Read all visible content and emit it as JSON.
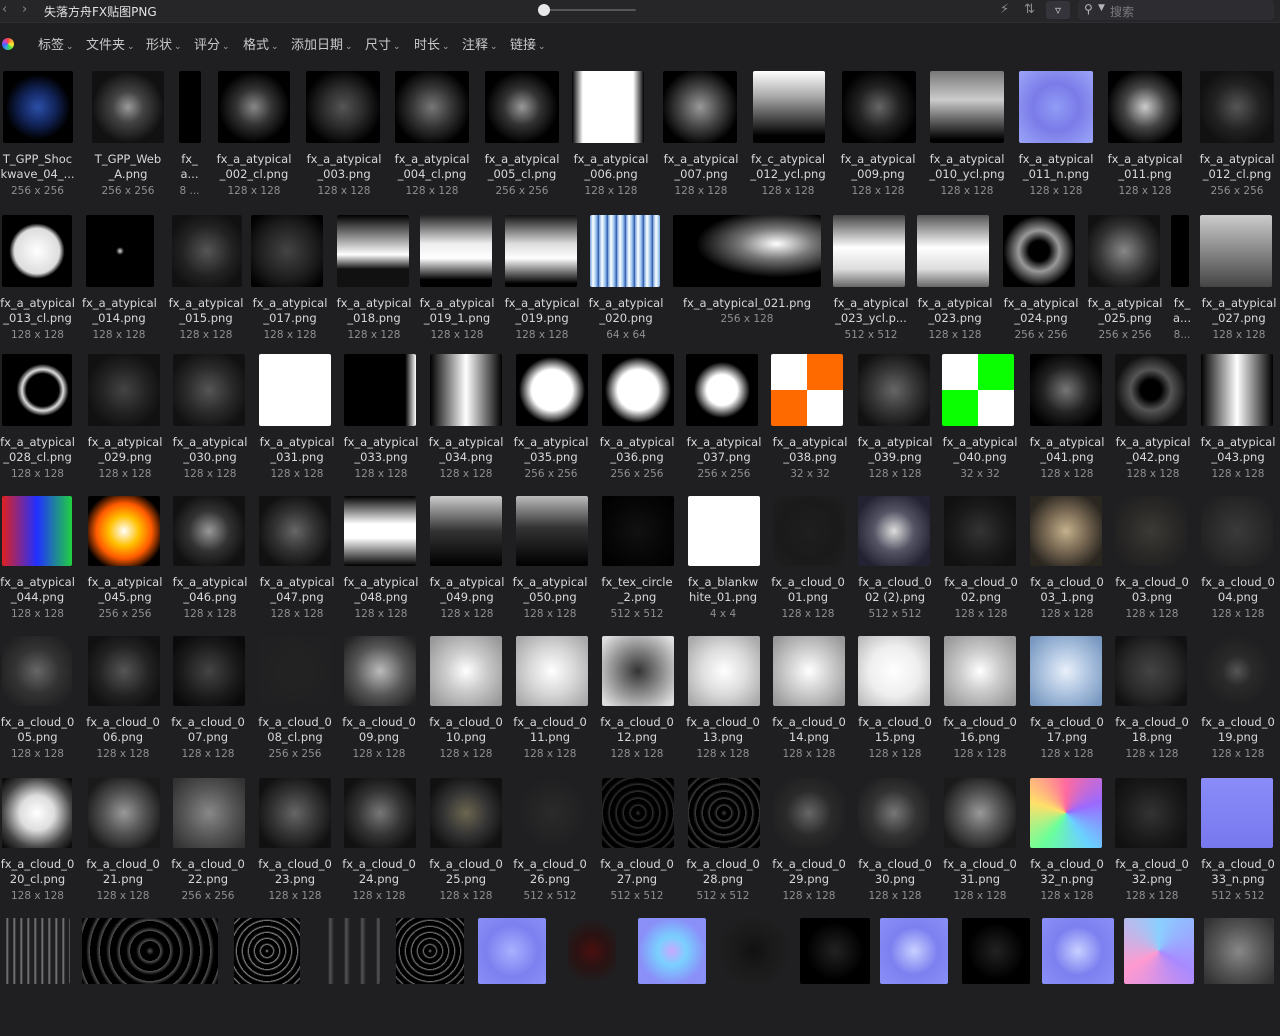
{
  "window": {
    "title": "失落方舟FX贴图PNG",
    "back_icon": "chevron-left-icon",
    "forward_icon": "chevron-right-icon"
  },
  "toolbar_icons": [
    "lightning-icon",
    "sort-icon",
    "filter-icon"
  ],
  "search": {
    "placeholder": "搜索"
  },
  "filters": [
    "标签",
    "文件夹",
    "形状",
    "评分",
    "格式",
    "添加日期",
    "尺寸",
    "时长",
    "注释",
    "链接"
  ],
  "rows": [
    [
      {
        "n1": "T_GPP_Shoc",
        "n2": "kwave_04_...",
        "dim": "256 x 256"
      },
      {
        "n1": "T_GPP_Web",
        "n2": "_A.png",
        "dim": "256 x 256"
      },
      {
        "n1": "fx_",
        "n2": "a...",
        "dim": "8 ..."
      },
      {
        "n1": "fx_a_atypical",
        "n2": "_002_cl.png",
        "dim": "128 x 128"
      },
      {
        "n1": "fx_a_atypical",
        "n2": "_003.png",
        "dim": "128 x 128"
      },
      {
        "n1": "fx_a_atypical",
        "n2": "_004_cl.png",
        "dim": "128 x 128"
      },
      {
        "n1": "fx_a_atypical",
        "n2": "_005_cl.png",
        "dim": "256 x 256"
      },
      {
        "n1": "fx_a_atypical",
        "n2": "_006.png",
        "dim": "128 x 128"
      },
      {
        "n1": "fx_a_atypical",
        "n2": "_007.png",
        "dim": "128 x 128"
      },
      {
        "n1": "fx_c_atypical",
        "n2": "_012_ycl.png",
        "dim": "128 x 128"
      },
      {
        "n1": "fx_a_atypical",
        "n2": "_009.png",
        "dim": "128 x 128"
      },
      {
        "n1": "fx_a_atypical",
        "n2": "_010_ycl.png",
        "dim": "128 x 128"
      },
      {
        "n1": "fx_a_atypical",
        "n2": "_011_n.png",
        "dim": "128 x 128"
      },
      {
        "n1": "fx_a_atypical",
        "n2": "_011.png",
        "dim": "128 x 128"
      },
      {
        "n1": "fx_a_atypical",
        "n2": "_012_cl.png",
        "dim": "256 x 256"
      }
    ],
    [
      {
        "n1": "fx_a_atypical",
        "n2": "_013_cl.png",
        "dim": "128 x 128"
      },
      {
        "n1": "fx_a_atypical",
        "n2": "_014.png",
        "dim": "128 x 128"
      },
      {
        "n1": "fx_a_atypical",
        "n2": "_015.png",
        "dim": "128 x 128"
      },
      {
        "n1": "fx_a_atypical",
        "n2": "_017.png",
        "dim": "128 x 128"
      },
      {
        "n1": "fx_a_atypical",
        "n2": "_018.png",
        "dim": "128 x 128"
      },
      {
        "n1": "fx_a_atypical",
        "n2": "_019_1.png",
        "dim": "128 x 128"
      },
      {
        "n1": "fx_a_atypical",
        "n2": "_019.png",
        "dim": "128 x 128"
      },
      {
        "n1": "fx_a_atypical",
        "n2": "_020.png",
        "dim": "64 x 64"
      },
      {
        "n1": "fx_a_atypical_021.png",
        "n2": "",
        "dim": "256 x 128"
      },
      {
        "n1": "fx_a_atypical",
        "n2": "_023_ycl.p...",
        "dim": "512 x 512"
      },
      {
        "n1": "fx_a_atypical",
        "n2": "_023.png",
        "dim": "128 x 128"
      },
      {
        "n1": "fx_a_atypical",
        "n2": "_024.png",
        "dim": "256 x 256"
      },
      {
        "n1": "fx_a_atypical",
        "n2": "_025.png",
        "dim": "256 x 256"
      },
      {
        "n1": "fx_",
        "n2": "a...",
        "dim": "8..."
      },
      {
        "n1": "fx_a_atypical",
        "n2": "_027.png",
        "dim": "128 x 128"
      }
    ],
    [
      {
        "n1": "fx_a_atypical",
        "n2": "_028_cl.png",
        "dim": "128 x 128"
      },
      {
        "n1": "fx_a_atypical",
        "n2": "_029.png",
        "dim": "128 x 128"
      },
      {
        "n1": "fx_a_atypical",
        "n2": "_030.png",
        "dim": "128 x 128"
      },
      {
        "n1": "fx_a_atypical",
        "n2": "_031.png",
        "dim": "128 x 128"
      },
      {
        "n1": "fx_a_atypical",
        "n2": "_033.png",
        "dim": "128 x 128"
      },
      {
        "n1": "fx_a_atypical",
        "n2": "_034.png",
        "dim": "128 x 128"
      },
      {
        "n1": "fx_a_atypical",
        "n2": "_035.png",
        "dim": "256 x 256"
      },
      {
        "n1": "fx_a_atypical",
        "n2": "_036.png",
        "dim": "256 x 256"
      },
      {
        "n1": "fx_a_atypical",
        "n2": "_037.png",
        "dim": "256 x 256"
      },
      {
        "n1": "fx_a_atypical",
        "n2": "_038.png",
        "dim": "32 x 32"
      },
      {
        "n1": "fx_a_atypical",
        "n2": "_039.png",
        "dim": "128 x 128"
      },
      {
        "n1": "fx_a_atypical",
        "n2": "_040.png",
        "dim": "32 x 32"
      },
      {
        "n1": "fx_a_atypical",
        "n2": "_041.png",
        "dim": "128 x 128"
      },
      {
        "n1": "fx_a_atypical",
        "n2": "_042.png",
        "dim": "128 x 128"
      },
      {
        "n1": "fx_a_atypical",
        "n2": "_043.png",
        "dim": "128 x 128"
      }
    ],
    [
      {
        "n1": "fx_a_atypical",
        "n2": "_044.png",
        "dim": "128 x 128"
      },
      {
        "n1": "fx_a_atypical",
        "n2": "_045.png",
        "dim": "256 x 256"
      },
      {
        "n1": "fx_a_atypical",
        "n2": "_046.png",
        "dim": "128 x 128"
      },
      {
        "n1": "fx_a_atypical",
        "n2": "_047.png",
        "dim": "128 x 128"
      },
      {
        "n1": "fx_a_atypical",
        "n2": "_048.png",
        "dim": "128 x 128"
      },
      {
        "n1": "fx_a_atypical",
        "n2": "_049.png",
        "dim": "128 x 128"
      },
      {
        "n1": "fx_a_atypical",
        "n2": "_050.png",
        "dim": "128 x 128"
      },
      {
        "n1": "fx_tex_circle",
        "n2": "_2.png",
        "dim": "512 x 512"
      },
      {
        "n1": "fx_a_blankw",
        "n2": "hite_01.png",
        "dim": "4 x 4"
      },
      {
        "n1": "fx_a_cloud_0",
        "n2": "01.png",
        "dim": "128 x 128"
      },
      {
        "n1": "fx_a_cloud_0",
        "n2": "02 (2).png",
        "dim": "512 x 512"
      },
      {
        "n1": "fx_a_cloud_0",
        "n2": "02.png",
        "dim": "128 x 128"
      },
      {
        "n1": "fx_a_cloud_0",
        "n2": "03_1.png",
        "dim": "128 x 128"
      },
      {
        "n1": "fx_a_cloud_0",
        "n2": "03.png",
        "dim": "128 x 128"
      },
      {
        "n1": "fx_a_cloud_0",
        "n2": "04.png",
        "dim": "128 x 128"
      }
    ],
    [
      {
        "n1": "fx_a_cloud_0",
        "n2": "05.png",
        "dim": "128 x 128"
      },
      {
        "n1": "fx_a_cloud_0",
        "n2": "06.png",
        "dim": "128 x 128"
      },
      {
        "n1": "fx_a_cloud_0",
        "n2": "07.png",
        "dim": "128 x 128"
      },
      {
        "n1": "fx_a_cloud_0",
        "n2": "08_cl.png",
        "dim": "256 x 256"
      },
      {
        "n1": "fx_a_cloud_0",
        "n2": "09.png",
        "dim": "128 x 128"
      },
      {
        "n1": "fx_a_cloud_0",
        "n2": "10.png",
        "dim": "128 x 128"
      },
      {
        "n1": "fx_a_cloud_0",
        "n2": "11.png",
        "dim": "128 x 128"
      },
      {
        "n1": "fx_a_cloud_0",
        "n2": "12.png",
        "dim": "128 x 128"
      },
      {
        "n1": "fx_a_cloud_0",
        "n2": "13.png",
        "dim": "128 x 128"
      },
      {
        "n1": "fx_a_cloud_0",
        "n2": "14.png",
        "dim": "128 x 128"
      },
      {
        "n1": "fx_a_cloud_0",
        "n2": "15.png",
        "dim": "128 x 128"
      },
      {
        "n1": "fx_a_cloud_0",
        "n2": "16.png",
        "dim": "128 x 128"
      },
      {
        "n1": "fx_a_cloud_0",
        "n2": "17.png",
        "dim": "128 x 128"
      },
      {
        "n1": "fx_a_cloud_0",
        "n2": "18.png",
        "dim": "128 x 128"
      },
      {
        "n1": "fx_a_cloud_0",
        "n2": "19.png",
        "dim": "128 x 128"
      }
    ],
    [
      {
        "n1": "fx_a_cloud_0",
        "n2": "20_cl.png",
        "dim": "128 x 128"
      },
      {
        "n1": "fx_a_cloud_0",
        "n2": "21.png",
        "dim": "128 x 128"
      },
      {
        "n1": "fx_a_cloud_0",
        "n2": "22.png",
        "dim": "256 x 256"
      },
      {
        "n1": "fx_a_cloud_0",
        "n2": "23.png",
        "dim": "128 x 128"
      },
      {
        "n1": "fx_a_cloud_0",
        "n2": "24.png",
        "dim": "128 x 128"
      },
      {
        "n1": "fx_a_cloud_0",
        "n2": "25.png",
        "dim": "128 x 128"
      },
      {
        "n1": "fx_a_cloud_0",
        "n2": "26.png",
        "dim": "512 x 512"
      },
      {
        "n1": "fx_a_cloud_0",
        "n2": "27.png",
        "dim": "512 x 512"
      },
      {
        "n1": "fx_a_cloud_0",
        "n2": "28.png",
        "dim": "512 x 512"
      },
      {
        "n1": "fx_a_cloud_0",
        "n2": "29.png",
        "dim": "128 x 128"
      },
      {
        "n1": "fx_a_cloud_0",
        "n2": "30.png",
        "dim": "128 x 128"
      },
      {
        "n1": "fx_a_cloud_0",
        "n2": "31.png",
        "dim": "128 x 128"
      },
      {
        "n1": "fx_a_cloud_0",
        "n2": "32_n.png",
        "dim": "128 x 128"
      },
      {
        "n1": "fx_a_cloud_0",
        "n2": "32.png",
        "dim": "128 x 128"
      },
      {
        "n1": "fx_a_cloud_0",
        "n2": "33_n.png",
        "dim": "512 x 512"
      }
    ],
    [
      {
        "n1": "",
        "n2": "",
        "dim": ""
      },
      {
        "n1": "",
        "n2": "",
        "dim": ""
      },
      {
        "n1": "",
        "n2": "",
        "dim": ""
      },
      {
        "n1": "",
        "n2": "",
        "dim": ""
      },
      {
        "n1": "",
        "n2": "",
        "dim": ""
      },
      {
        "n1": "",
        "n2": "",
        "dim": ""
      },
      {
        "n1": "",
        "n2": "",
        "dim": ""
      },
      {
        "n1": "",
        "n2": "",
        "dim": ""
      },
      {
        "n1": "",
        "n2": "",
        "dim": ""
      },
      {
        "n1": "",
        "n2": "",
        "dim": ""
      },
      {
        "n1": "",
        "n2": "",
        "dim": ""
      },
      {
        "n1": "",
        "n2": "",
        "dim": ""
      },
      {
        "n1": "",
        "n2": "",
        "dim": ""
      },
      {
        "n1": "",
        "n2": "",
        "dim": ""
      },
      {
        "n1": "",
        "n2": "",
        "dim": ""
      },
      {
        "n1": "",
        "n2": "",
        "dim": ""
      }
    ]
  ]
}
